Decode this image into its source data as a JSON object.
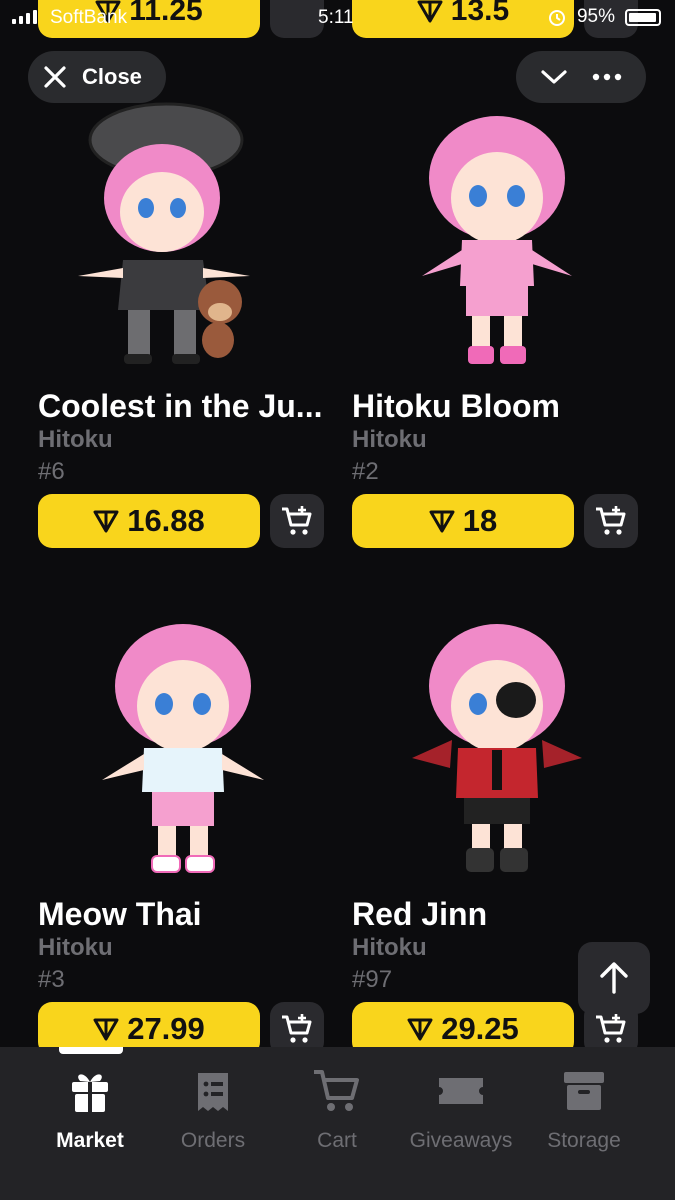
{
  "status_bar": {
    "carrier": "SoftBank",
    "time": "5:11",
    "battery": "95%"
  },
  "peek_row": {
    "left_price": "11.25",
    "right_price": "13.5"
  },
  "header": {
    "close_label": "Close"
  },
  "items": [
    {
      "name": "Coolest in the Ju...",
      "collection": "Hitoku",
      "number": "#6",
      "price": "16.88"
    },
    {
      "name": "Hitoku Bloom",
      "collection": "Hitoku",
      "number": "#2",
      "price": "18"
    },
    {
      "name": "Meow Thai",
      "collection": "Hitoku",
      "number": "#3",
      "price": "27.99"
    },
    {
      "name": "Red Jinn",
      "collection": "Hitoku",
      "number": "#97",
      "price": "29.25"
    }
  ],
  "tabs": [
    {
      "label": "Market",
      "icon": "gift-icon",
      "active": true
    },
    {
      "label": "Orders",
      "icon": "receipt-icon",
      "active": false
    },
    {
      "label": "Cart",
      "icon": "cart-icon",
      "active": false
    },
    {
      "label": "Giveaways",
      "icon": "ticket-icon",
      "active": false
    },
    {
      "label": "Storage",
      "icon": "archive-box-icon",
      "active": false
    }
  ],
  "colors": {
    "background": "#0c0c0e",
    "accent_yellow": "#f9d51c",
    "button_dark": "#2a2a2e",
    "muted_text": "#6e6e73",
    "tabbar": "#232326"
  }
}
